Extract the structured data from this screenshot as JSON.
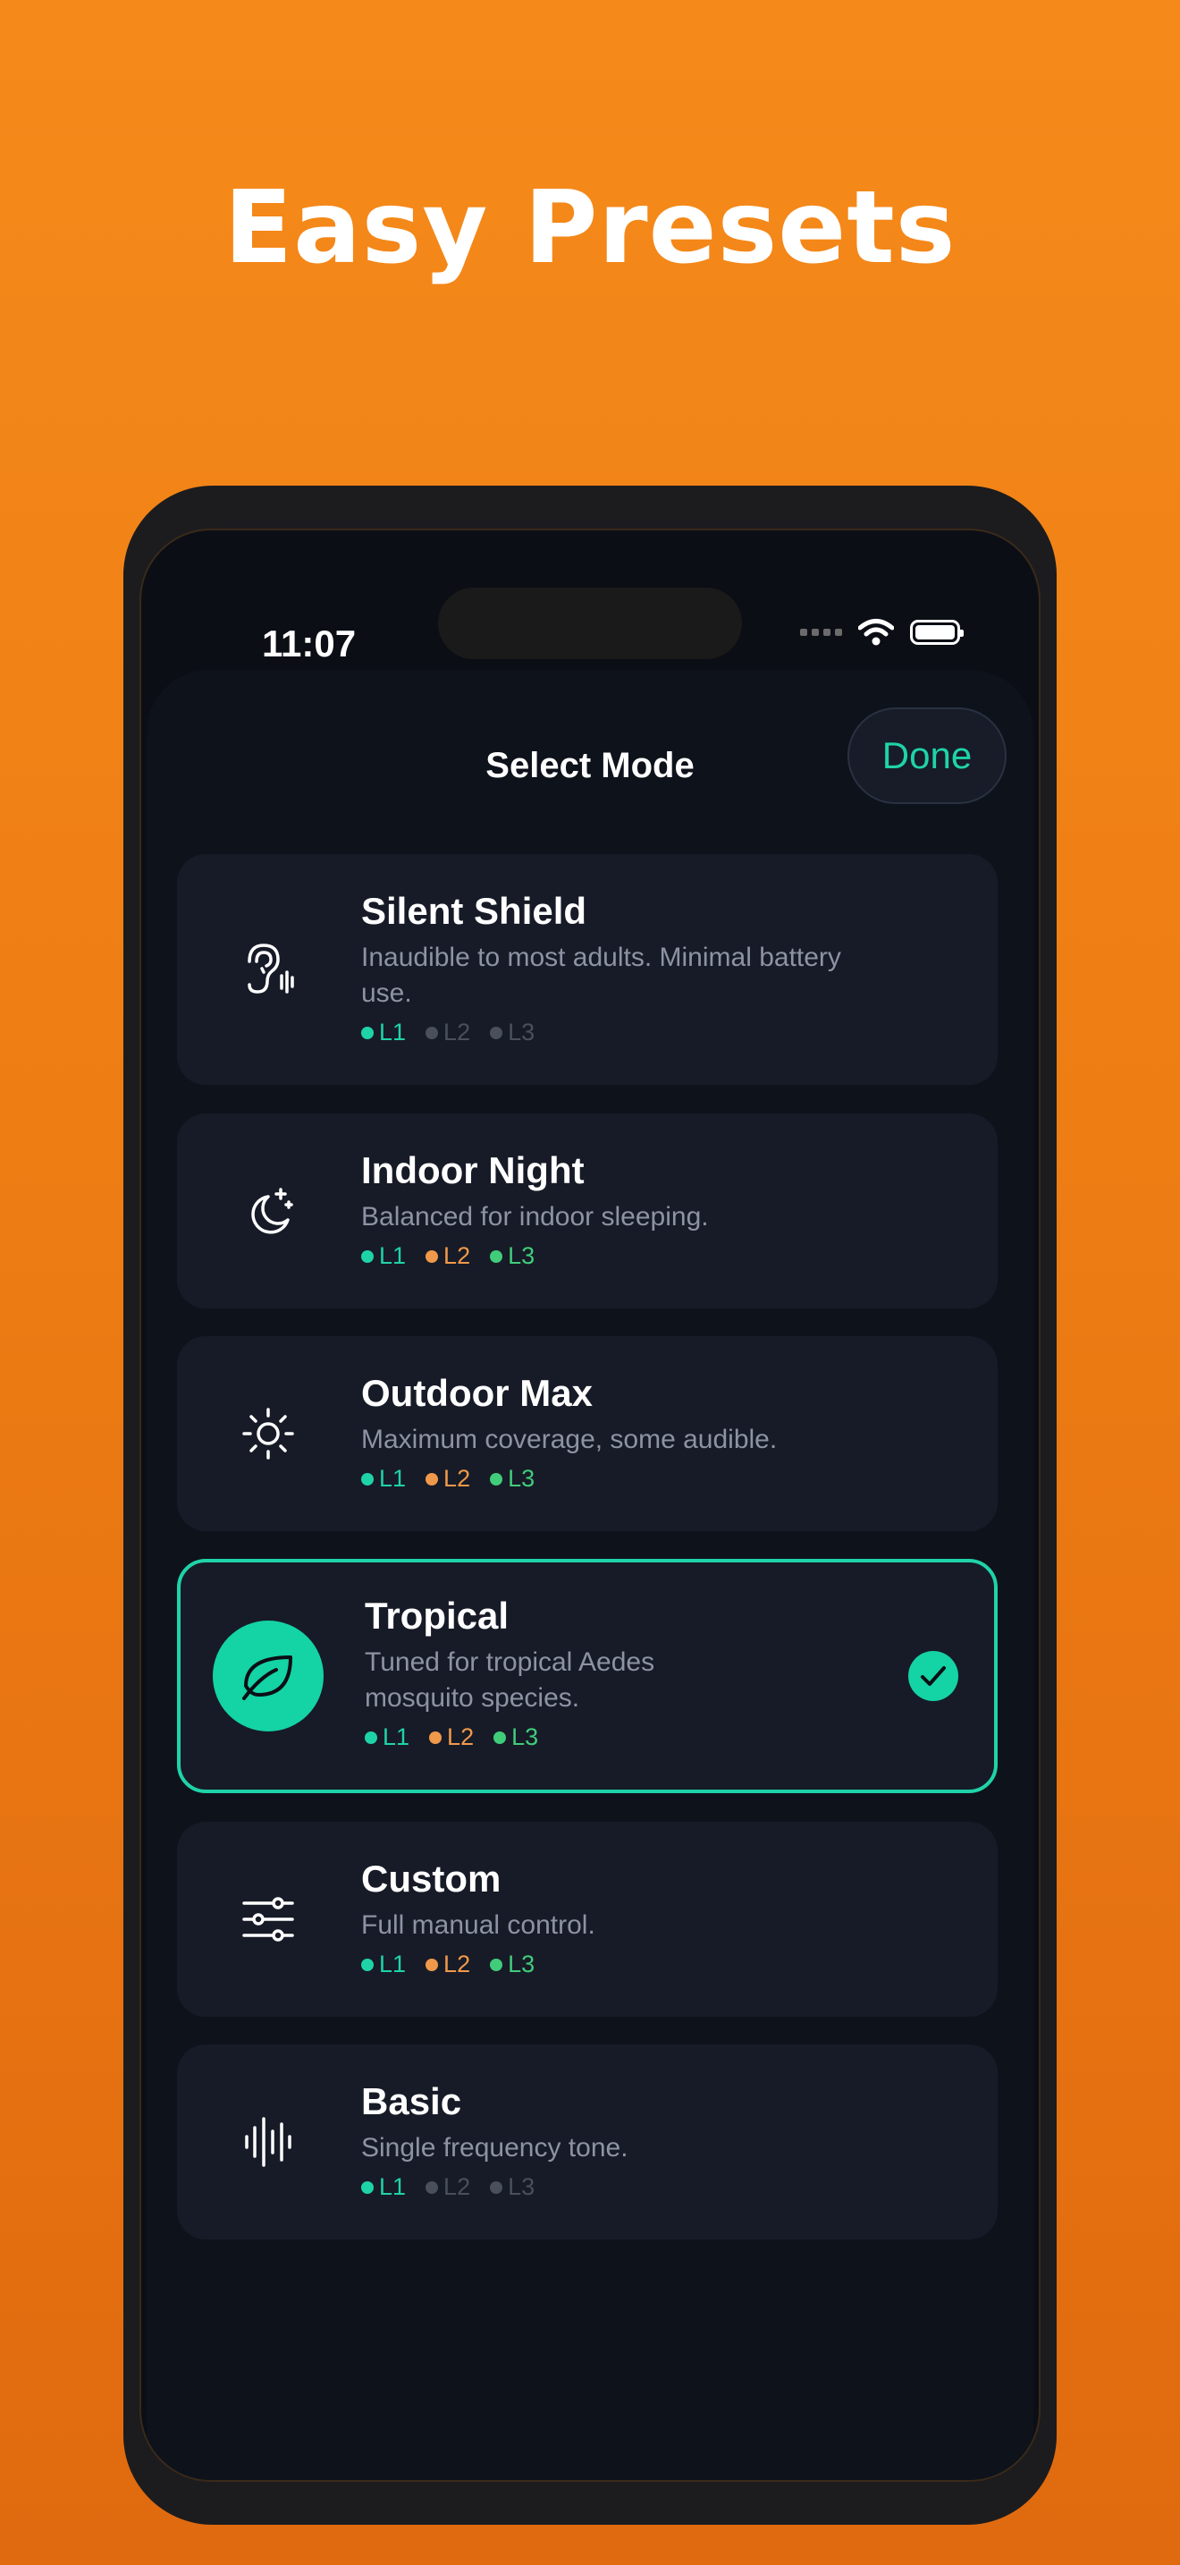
{
  "headline": "Easy Presets",
  "status": {
    "time": "11:07"
  },
  "sheet": {
    "title": "Select Mode",
    "done_label": "Done"
  },
  "colors": {
    "accent": "#1fd3a8",
    "active_teal": "#1fd3a8",
    "active_orange": "#f0994a",
    "active_green": "#41cc7a",
    "inactive": "#4a4f5c"
  },
  "modes": [
    {
      "name": "Silent Shield",
      "desc": "Inaudible to most adults. Minimal battery use.",
      "icon": "ear-icon",
      "levels": [
        {
          "label": "L1",
          "state": "teal"
        },
        {
          "label": "L2",
          "state": "off"
        },
        {
          "label": "L3",
          "state": "off"
        }
      ],
      "selected": false
    },
    {
      "name": "Indoor Night",
      "desc": "Balanced for indoor sleeping.",
      "icon": "moon-stars-icon",
      "levels": [
        {
          "label": "L1",
          "state": "teal"
        },
        {
          "label": "L2",
          "state": "orange"
        },
        {
          "label": "L3",
          "state": "green"
        }
      ],
      "selected": false
    },
    {
      "name": "Outdoor Max",
      "desc": "Maximum coverage, some audible.",
      "icon": "sun-icon",
      "levels": [
        {
          "label": "L1",
          "state": "teal"
        },
        {
          "label": "L2",
          "state": "orange"
        },
        {
          "label": "L3",
          "state": "green"
        }
      ],
      "selected": false
    },
    {
      "name": "Tropical",
      "desc": "Tuned for tropical Aedes mosquito species.",
      "icon": "leaf-icon",
      "levels": [
        {
          "label": "L1",
          "state": "teal"
        },
        {
          "label": "L2",
          "state": "orange"
        },
        {
          "label": "L3",
          "state": "green"
        }
      ],
      "selected": true
    },
    {
      "name": "Custom",
      "desc": "Full manual control.",
      "icon": "sliders-icon",
      "levels": [
        {
          "label": "L1",
          "state": "teal"
        },
        {
          "label": "L2",
          "state": "orange"
        },
        {
          "label": "L3",
          "state": "green"
        }
      ],
      "selected": false
    },
    {
      "name": "Basic",
      "desc": "Single frequency tone.",
      "icon": "waveform-icon",
      "levels": [
        {
          "label": "L1",
          "state": "teal"
        },
        {
          "label": "L2",
          "state": "off"
        },
        {
          "label": "L3",
          "state": "off"
        }
      ],
      "selected": false
    }
  ]
}
